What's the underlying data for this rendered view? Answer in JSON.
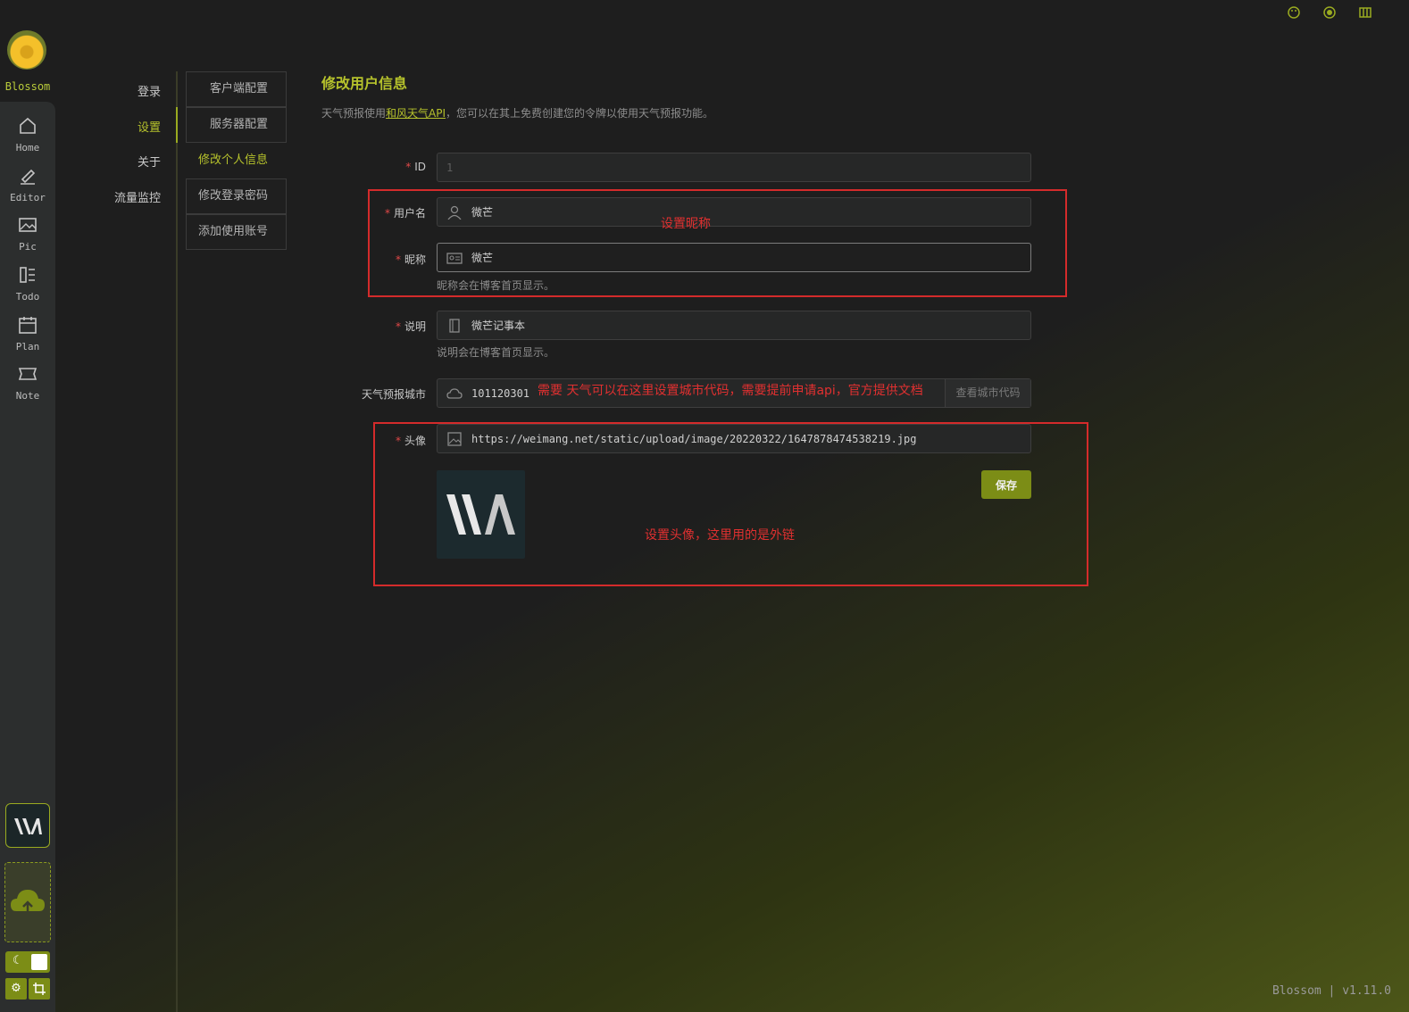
{
  "app": {
    "name": "Blossom",
    "footer": "Blossom | v1.11.0"
  },
  "rail": {
    "items": [
      {
        "label": "Home",
        "icon": "home-icon"
      },
      {
        "label": "Editor",
        "icon": "editor-icon"
      },
      {
        "label": "Pic",
        "icon": "picture-icon"
      },
      {
        "label": "Todo",
        "icon": "todo-icon"
      },
      {
        "label": "Plan",
        "icon": "calendar-icon"
      },
      {
        "label": "Note",
        "icon": "note-icon"
      }
    ]
  },
  "menu1": {
    "items": [
      "登录",
      "设置",
      "关于",
      "流量监控"
    ],
    "active": "设置"
  },
  "menu2": {
    "items": [
      "客户端配置",
      "服务器配置",
      "修改个人信息",
      "修改登录密码",
      "添加使用账号"
    ],
    "active": "修改个人信息"
  },
  "page": {
    "title": "修改用户信息",
    "desc_prefix": "天气预报使用",
    "desc_link": "和风天气API",
    "desc_suffix": "，您可以在其上免费创建您的令牌以使用天气预报功能。"
  },
  "form": {
    "id": {
      "label": "ID",
      "value": "1"
    },
    "username": {
      "label": "用户名",
      "value": "微芒"
    },
    "nickname": {
      "label": "昵称",
      "value": "微芒",
      "hint": "昵称会在博客首页显示。"
    },
    "remark": {
      "label": "说明",
      "value": "微芒记事本",
      "hint": "说明会在博客首页显示。"
    },
    "city": {
      "label": "天气预报城市",
      "value": "101120301",
      "addon": "查看城市代码"
    },
    "avatar": {
      "label": "头像",
      "value": "https://weimang.net/static/upload/image/20220322/1647878474538219.jpg"
    },
    "save": "保存"
  },
  "annotations": {
    "nickname": "设置昵称",
    "city": "需要 天气可以在这里设置城市代码，需要提前申请api，官方提供文档",
    "avatar": "设置头像，这里用的是外链"
  },
  "colors": {
    "accent": "#9aab20",
    "annotation": "#d42b2b"
  }
}
